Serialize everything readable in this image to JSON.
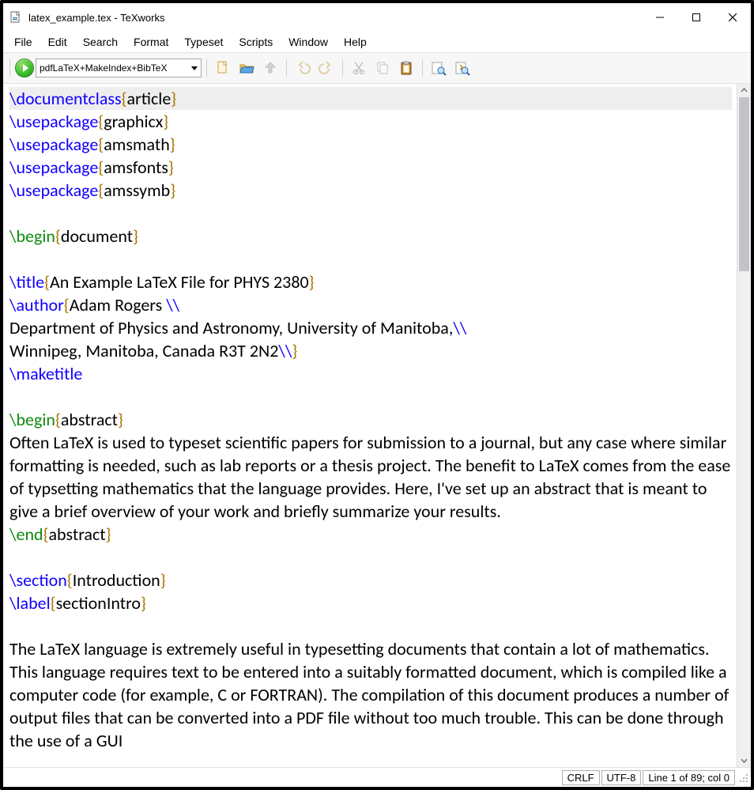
{
  "window": {
    "title": "latex_example.tex - TeXworks"
  },
  "menubar": {
    "items": [
      "File",
      "Edit",
      "Search",
      "Format",
      "Typeset",
      "Scripts",
      "Window",
      "Help"
    ]
  },
  "toolbar": {
    "engine_combo": "pdfLaTeX+MakeIndex+BibTeX",
    "icons": {
      "run": "run-typeset-icon",
      "new": "new-file-icon",
      "open": "open-file-icon",
      "save": "save-file-icon",
      "undo": "undo-icon",
      "redo": "redo-icon",
      "cut": "cut-icon",
      "copy": "copy-icon",
      "paste": "paste-icon",
      "find": "find-icon",
      "replace": "replace-icon"
    }
  },
  "editor_tokens": [
    [
      [
        "cs",
        "\\documentclass"
      ],
      [
        "brk",
        "{"
      ],
      [
        "arg",
        "article"
      ],
      [
        "brk",
        "}"
      ]
    ],
    [
      [
        "cs",
        "\\usepackage"
      ],
      [
        "brk",
        "{"
      ],
      [
        "arg",
        "graphicx"
      ],
      [
        "brk",
        "}"
      ]
    ],
    [
      [
        "cs",
        "\\usepackage"
      ],
      [
        "brk",
        "{"
      ],
      [
        "arg",
        "amsmath"
      ],
      [
        "brk",
        "}"
      ]
    ],
    [
      [
        "cs",
        "\\usepackage"
      ],
      [
        "brk",
        "{"
      ],
      [
        "arg",
        "amsfonts"
      ],
      [
        "brk",
        "}"
      ]
    ],
    [
      [
        "cs",
        "\\usepackage"
      ],
      [
        "brk",
        "{"
      ],
      [
        "arg",
        "amssymb"
      ],
      [
        "brk",
        "}"
      ]
    ],
    [],
    [
      [
        "env",
        "\\begin"
      ],
      [
        "brk",
        "{"
      ],
      [
        "arg",
        "document"
      ],
      [
        "brk",
        "}"
      ]
    ],
    [],
    [
      [
        "cs",
        "\\title"
      ],
      [
        "brk",
        "{"
      ],
      [
        "arg",
        "An Example LaTeX File for PHYS 2380"
      ],
      [
        "brk",
        "}"
      ]
    ],
    [
      [
        "cs",
        "\\author"
      ],
      [
        "brk",
        "{"
      ],
      [
        "arg",
        "Adam Rogers "
      ],
      [
        "cs",
        "\\\\"
      ]
    ],
    [
      [
        "arg",
        "Department of Physics and Astronomy, University of Manitoba,"
      ],
      [
        "cs",
        "\\\\"
      ]
    ],
    [
      [
        "arg",
        "Winnipeg, Manitoba, Canada R3T 2N2"
      ],
      [
        "cs",
        "\\\\"
      ],
      [
        "brk",
        "}"
      ]
    ],
    [
      [
        "cs",
        "\\maketitle"
      ]
    ],
    [],
    [
      [
        "env",
        "\\begin"
      ],
      [
        "brk",
        "{"
      ],
      [
        "arg",
        "abstract"
      ],
      [
        "brk",
        "}"
      ]
    ],
    [
      [
        "arg",
        "Often LaTeX is used to typeset scientific papers for submission to a journal, but any case where similar formatting is needed, such as lab reports or a thesis project. The benefit to LaTeX comes from the ease of typsetting mathematics that the language provides. Here, I've set up an abstract that is meant to give a brief overview of your work and briefly summarize your results."
      ]
    ],
    [
      [
        "env",
        "\\end"
      ],
      [
        "brk",
        "{"
      ],
      [
        "arg",
        "abstract"
      ],
      [
        "brk",
        "}"
      ]
    ],
    [],
    [
      [
        "cs",
        "\\section"
      ],
      [
        "brk",
        "{"
      ],
      [
        "arg",
        "Introduction"
      ],
      [
        "brk",
        "}"
      ]
    ],
    [
      [
        "cs",
        "\\label"
      ],
      [
        "brk",
        "{"
      ],
      [
        "arg",
        "sectionIntro"
      ],
      [
        "brk",
        "}"
      ]
    ],
    [],
    [
      [
        "arg",
        "The LaTeX language is extremely useful in typesetting documents that contain a lot of mathematics. This language requires text to be entered into a suitably formatted document, which is compiled like a computer code (for example, C or FORTRAN). The compilation of this document produces a number of output files that can be converted into a PDF file without too much trouble. This can be done through the use of a GUI"
      ]
    ]
  ],
  "statusbar": {
    "line_ending": "CRLF",
    "encoding": "UTF-8",
    "position": "Line 1 of 89; col 0"
  }
}
